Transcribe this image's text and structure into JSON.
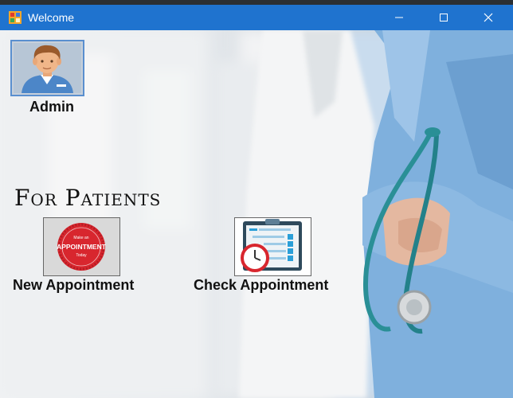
{
  "window": {
    "title": "Welcome"
  },
  "admin": {
    "label": "Admin"
  },
  "patients": {
    "heading": "For Patients",
    "new_appointment": {
      "label": "New Appointment",
      "badge_top": "Make an",
      "badge_main": "APPOINTMENT",
      "badge_bottom": "Today"
    },
    "check_appointment": {
      "label": "Check Appointment"
    }
  },
  "colors": {
    "titlebar": "#1f73cf",
    "badge_red": "#d8262e",
    "scrub_blue": "#7fb0dd"
  }
}
